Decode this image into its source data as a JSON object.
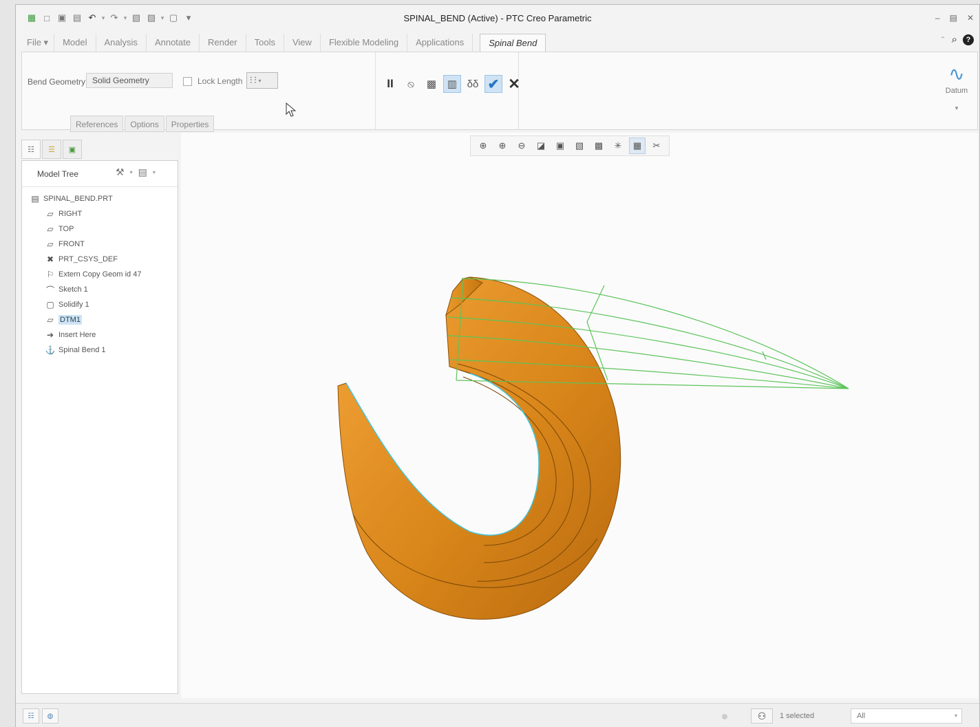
{
  "window": {
    "title": "SPINAL_BEND (Active) - PTC Creo Parametric",
    "controls": [
      "–",
      "▤",
      "✕"
    ]
  },
  "quick_access": [
    "▦",
    "□",
    "▣",
    "▤",
    "↶",
    "↷",
    "▧",
    "▨",
    "▢",
    "▾"
  ],
  "menu": {
    "file": "File ▾",
    "tabs": [
      "Model",
      "Analysis",
      "Annotate",
      "Render",
      "Tools",
      "View",
      "Flexible Modeling",
      "Applications"
    ],
    "active_tab": "Spinal Bend"
  },
  "top_right": {
    "help": "?",
    "search": "⌕",
    "collapse": "⌃"
  },
  "ribbon": {
    "bend_geometry_label": "Bend Geometry",
    "bend_geometry_value": "Solid Geometry",
    "lock_length_label": "Lock Length",
    "lock_length_checked": false,
    "subtabs": [
      "References",
      "Options",
      "Properties"
    ],
    "actions": {
      "pause": "II",
      "no_preview": "⦸",
      "preview_attached": "▩",
      "verify": "▥",
      "glasses": "δδ",
      "ok": "✔",
      "cancel": "✕"
    },
    "datum": {
      "label": "Datum",
      "icon": "∿",
      "more": "▾"
    }
  },
  "navigator": {
    "tabs": [
      "☷",
      "☰",
      "▣"
    ],
    "title": "Model Tree",
    "tree": [
      {
        "label": "SPINAL_BEND.PRT",
        "icon": "▤",
        "level": "root",
        "selected": false
      },
      {
        "label": "RIGHT",
        "icon": "▱",
        "level": "child",
        "selected": false
      },
      {
        "label": "TOP",
        "icon": "▱",
        "level": "child",
        "selected": false
      },
      {
        "label": "FRONT",
        "icon": "▱",
        "level": "child",
        "selected": false
      },
      {
        "label": "PRT_CSYS_DEF",
        "icon": "✖",
        "level": "child",
        "selected": false
      },
      {
        "label": "Extern Copy Geom id 47",
        "icon": "⚐",
        "level": "child",
        "selected": false
      },
      {
        "label": "Sketch 1",
        "icon": "⌒",
        "level": "child",
        "selected": false
      },
      {
        "label": "Solidify 1",
        "icon": "▢",
        "level": "child",
        "selected": false
      },
      {
        "label": "DTM1",
        "icon": "▱",
        "level": "child",
        "selected": true
      },
      {
        "label": "Insert Here",
        "icon": "➔",
        "level": "child",
        "selected": false
      },
      {
        "label": "Spinal Bend 1",
        "icon": "⚓",
        "level": "child",
        "selected": false
      }
    ]
  },
  "view_toolbar": [
    "⊕",
    "⊕",
    "⊖",
    "◪",
    "▣",
    "▧",
    "▩",
    "✳",
    "▦",
    "✂"
  ],
  "status": {
    "selected": "1 selected",
    "filter": "All",
    "find_icon": "⚇"
  },
  "colors": {
    "model_orange": "#d98a1a",
    "preview_green": "#5cc45a",
    "selection_blue": "#cfe3f4"
  }
}
